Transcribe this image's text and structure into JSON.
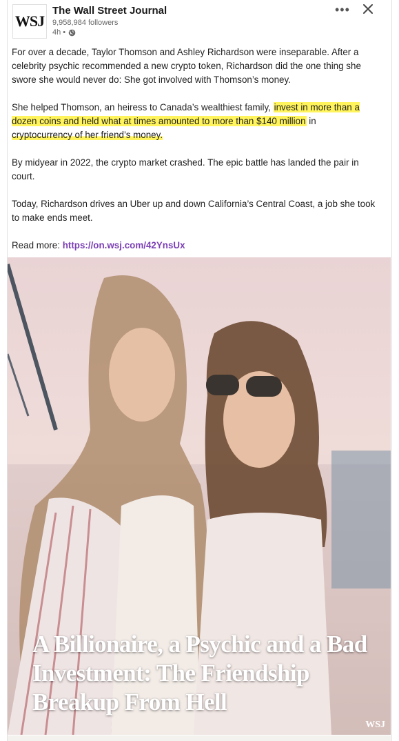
{
  "header": {
    "logo_text": "WSJ",
    "company_name": "The Wall Street Journal",
    "followers": "9,958,984 followers",
    "time": "4h •"
  },
  "post": {
    "p1": "For over a decade, Taylor Thomson and Ashley Richardson were inseparable. After a celebrity psychic recommended a new crypto token, Richardson did the one thing she swore she would never do: She got involved with Thomson’s money.",
    "p2_before": "She helped Thomson, an heiress to Canada’s wealthiest family, ",
    "p2_highlight": "invest in more than a dozen coins and held what at times amounted to more than $140 million",
    "p2_mid": " in ",
    "p2_underline": "cryptocurrency of her friend’s money.",
    "p3": "By midyear in 2022, the crypto market crashed. The epic battle has landed the pair in court.",
    "p4": "Today, Richardson drives an Uber up and down California’s Central Coast, a job she took to make ends meet.",
    "read_more_label": "Read more: ",
    "read_more_link": "https://on.wsj.com/42YnsUx"
  },
  "image": {
    "headline": "A Billionaire, a Psychic and a Bad Investment: The Friendship Breakup From Hell",
    "watermark": "WSJ"
  },
  "icons": {
    "more": "more-icon",
    "close": "close-icon",
    "visibility": "globe-icon"
  },
  "colors": {
    "highlight": "#fff45c",
    "link": "#7b3fb5"
  }
}
